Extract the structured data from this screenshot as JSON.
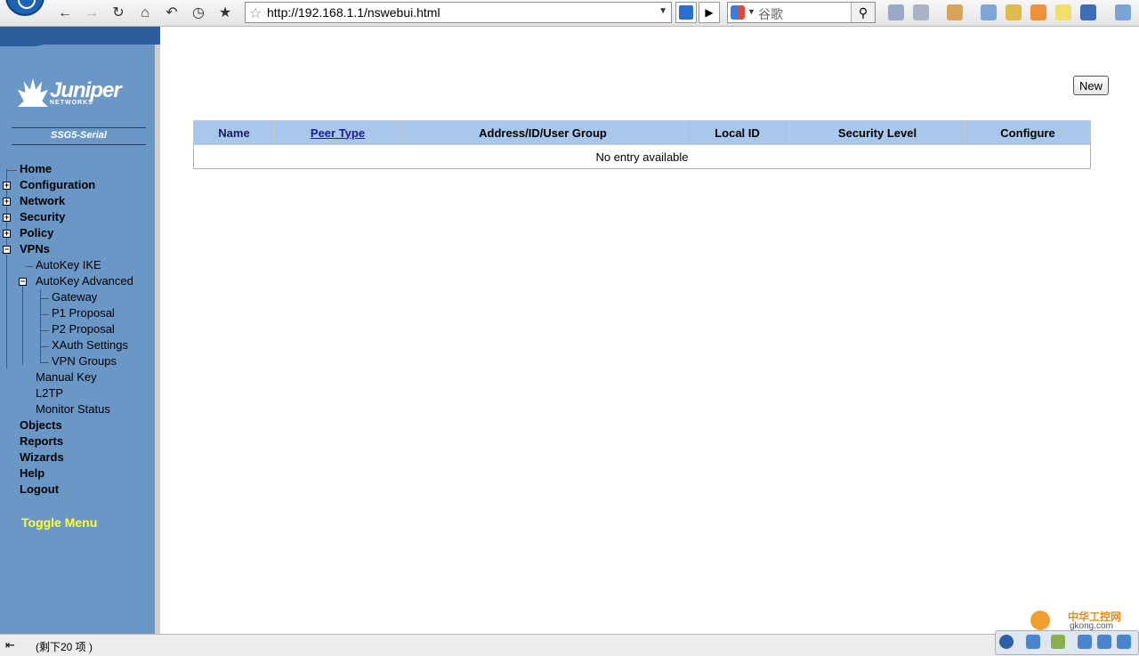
{
  "browser": {
    "url": "http://192.168.1.1/nswebui.html",
    "search_placeholder": "谷歌"
  },
  "sidebar": {
    "brand": "Juniper",
    "brand_sub": "NETWORKS",
    "device": "SSG5-Serial",
    "nav": {
      "home": "Home",
      "configuration": "Configuration",
      "network": "Network",
      "security": "Security",
      "policy": "Policy",
      "vpns": "VPNs",
      "autokey_ike": "AutoKey IKE",
      "autokey_advanced": "AutoKey Advanced",
      "gateway": "Gateway",
      "p1_proposal": "P1 Proposal",
      "p2_proposal": "P2 Proposal",
      "xauth_settings": "XAuth Settings",
      "vpn_groups": "VPN Groups",
      "manual_key": "Manual Key",
      "l2tp": "L2TP",
      "monitor_status": "Monitor Status",
      "objects": "Objects",
      "reports": "Reports",
      "wizards": "Wizards",
      "help": "Help",
      "logout": "Logout"
    },
    "toggle": "Toggle Menu"
  },
  "main": {
    "new_button": "New",
    "columns": {
      "name": "Name",
      "peer_type": "Peer Type",
      "address": "Address/ID/User Group",
      "local_id": "Local ID",
      "security_level": "Security Level",
      "configure": "Configure"
    },
    "empty_message": "No entry available"
  },
  "status": {
    "text": "(剩下20 项 )"
  },
  "watermark": {
    "title": "中华工控网",
    "site": "gkong.com"
  }
}
